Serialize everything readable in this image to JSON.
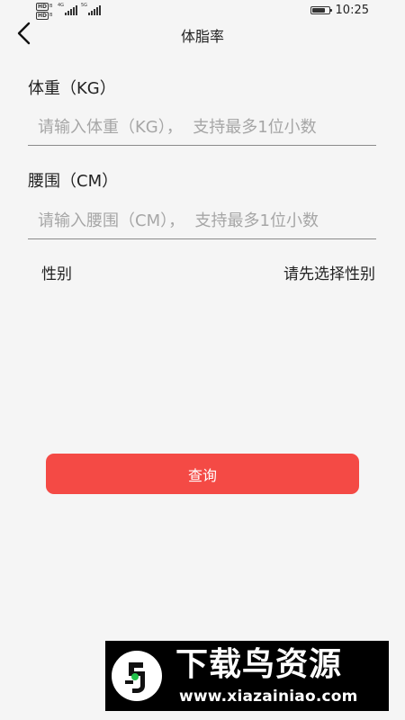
{
  "status_bar": {
    "sim1_badge": "HD",
    "sim1_slot": "B",
    "sim1_network": "4G",
    "sim2_badge": "HD",
    "sim2_slot": "B",
    "sim2_network": "5G",
    "time": "10:25",
    "battery_level": 0.85
  },
  "header": {
    "title": "体脂率",
    "back_icon": "chevron-left-icon"
  },
  "form": {
    "weight": {
      "label": "体重（KG）",
      "value": "",
      "placeholder": "请输入体重（KG），  支持最多1位小数"
    },
    "waist": {
      "label": "腰围（CM）",
      "value": "",
      "placeholder": "请输入腰围（CM），  支持最多1位小数"
    },
    "gender": {
      "label": "性别",
      "value": "请先选择性别"
    }
  },
  "query_button": {
    "label": "查询"
  },
  "watermark": {
    "title": "下载鸟资源",
    "url": "www.xiazainiao.com"
  },
  "colors": {
    "accent": "#f44a45",
    "background": "#f5f5f5",
    "divider": "#8a8a8a",
    "placeholder": "#a6a6a6",
    "watermark_bg": "#000000",
    "logo_green": "#22c24a"
  }
}
